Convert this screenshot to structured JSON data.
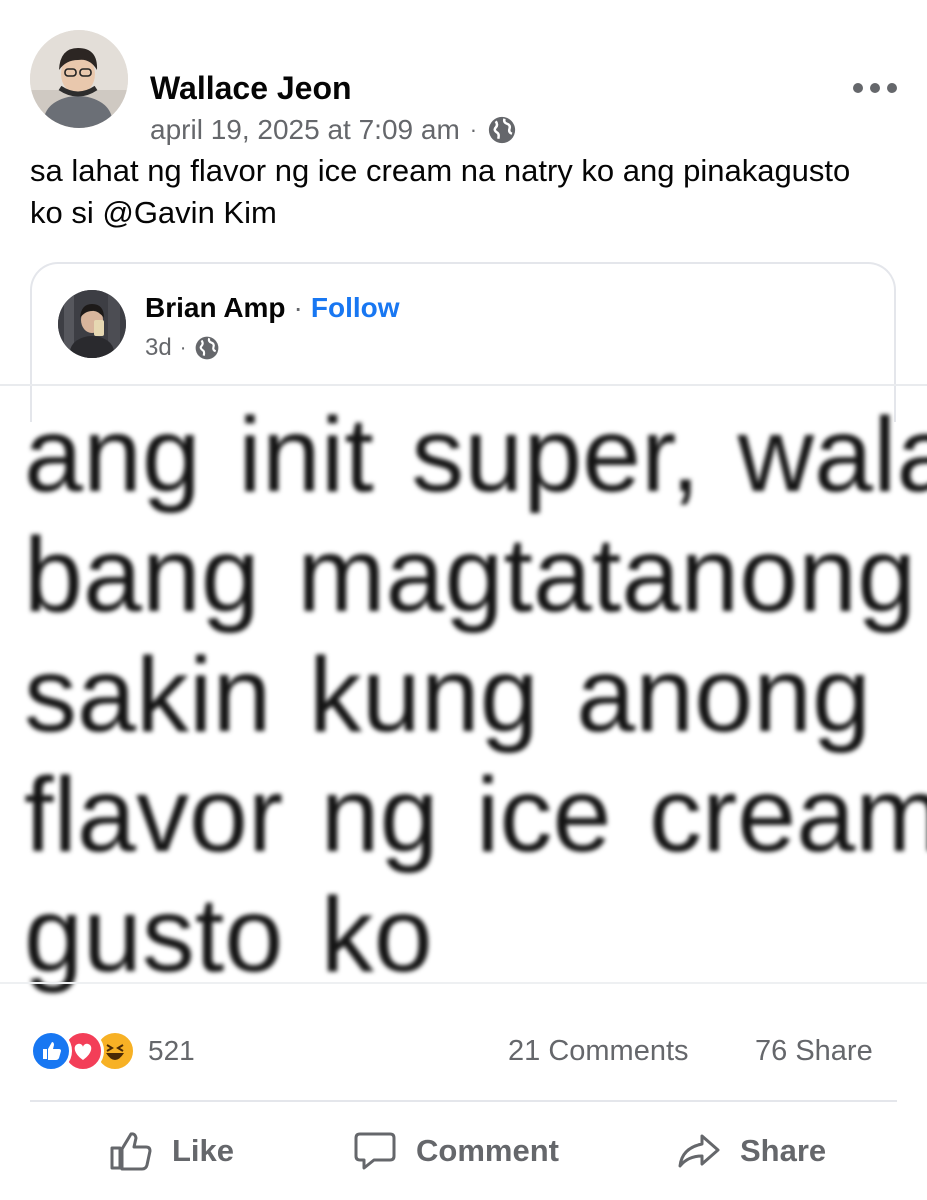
{
  "post": {
    "author": "Wallace Jeon",
    "timestamp": "april 19, 2025 at 7:09 am",
    "privacy_icon": "globe-icon",
    "text": "sa lahat ng flavor ng ice cream na natry ko ang pinakagusto ko si @Gavin Kim"
  },
  "shared_post": {
    "author": "Brian Amp",
    "separator": "·",
    "follow_label": "Follow",
    "time": "3d",
    "privacy_icon": "globe-icon",
    "image_text_lines": [
      "ang init super, wala",
      "bang  magtatanong",
      "sakin  kung  anong",
      "flavor ng ice cream",
      "gusto ko"
    ]
  },
  "stats": {
    "reaction_icons": [
      "like-react-icon",
      "love-react-icon",
      "haha-react-icon"
    ],
    "reaction_count": "521",
    "comments": "21 Comments",
    "shares": "76 Share"
  },
  "actions": {
    "like_label": "Like",
    "comment_label": "Comment",
    "share_label": "Share"
  },
  "colors": {
    "link": "#1877f2",
    "secondary_text": "#65676b",
    "like": "#1877f2",
    "love": "#f33e58",
    "haha": "#f7b125"
  }
}
